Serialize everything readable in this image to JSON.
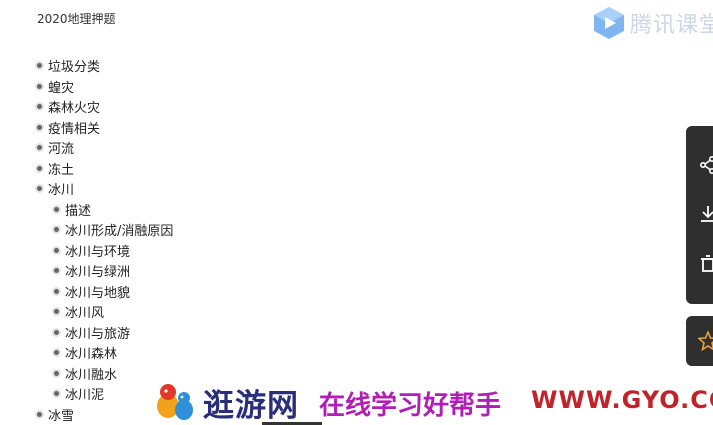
{
  "header": {
    "title": "2020地理押题"
  },
  "brand": {
    "text": "腾讯课堂",
    "color": "#cfd6e6"
  },
  "outline": {
    "items": [
      {
        "label": "垃圾分类",
        "level": 0
      },
      {
        "label": "蝗灾",
        "level": 0
      },
      {
        "label": "森林火灾",
        "level": 0
      },
      {
        "label": "疫情相关",
        "level": 0
      },
      {
        "label": "河流",
        "level": 0
      },
      {
        "label": "冻土",
        "level": 0
      },
      {
        "label": "冰川",
        "level": 0
      },
      {
        "label": "描述",
        "level": 1
      },
      {
        "label": "冰川形成/消融原因",
        "level": 1
      },
      {
        "label": "冰川与环境",
        "level": 1
      },
      {
        "label": "冰川与绿洲",
        "level": 1
      },
      {
        "label": "冰川与地貌",
        "level": 1
      },
      {
        "label": "冰川风",
        "level": 1
      },
      {
        "label": "冰川与旅游",
        "level": 1
      },
      {
        "label": "冰川森林",
        "level": 1
      },
      {
        "label": "冰川融水",
        "level": 1
      },
      {
        "label": "冰川泥",
        "level": 1
      },
      {
        "label": "冰雪",
        "level": 0
      }
    ]
  },
  "toolbar": {
    "icons": [
      "share-icon",
      "download-icon",
      "delete-icon"
    ],
    "extra_icon": "star-icon",
    "background": "#2f2f2f"
  },
  "banner": {
    "logo": "逛游网",
    "tagline": "在线学习好帮手",
    "url": "WWW.GYO.CC"
  }
}
